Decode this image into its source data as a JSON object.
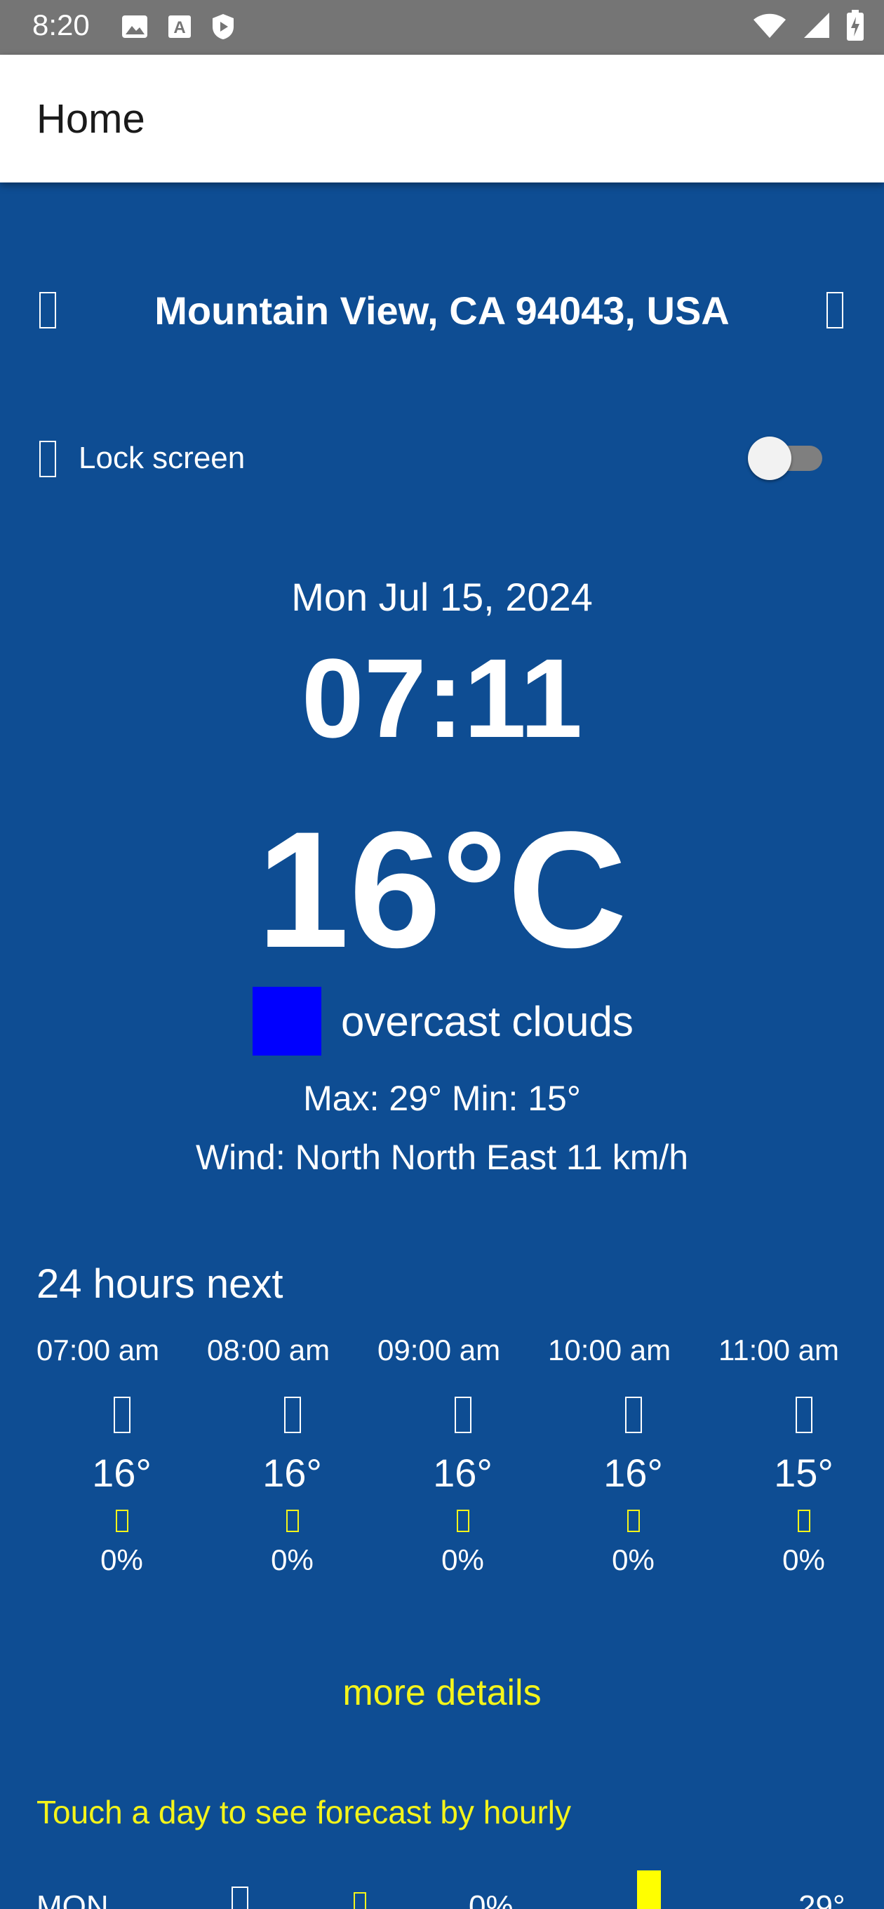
{
  "status_bar": {
    "time": "8:20",
    "left_icons": [
      "image-icon",
      "font-a-icon",
      "shield-play-icon"
    ],
    "right_icons": [
      "wifi-icon",
      "signal-icon",
      "battery-charging-icon"
    ]
  },
  "app_bar": {
    "title": "Home"
  },
  "header": {
    "location": "Mountain View, CA 94043, USA",
    "left_icon": "placeholder-icon",
    "right_icon": "placeholder-icon"
  },
  "lock": {
    "label": "Lock screen",
    "toggle_on": false
  },
  "current": {
    "date": "Mon Jul 15, 2024",
    "time": "07:11",
    "temperature": "16°C",
    "condition": "overcast clouds",
    "condition_swatch_color": "#0000ff",
    "max_min": "Max: 29° Min: 15°",
    "wind": "Wind: North North East 11 km/h"
  },
  "hourly": {
    "title": "24 hours next",
    "items": [
      {
        "time": "07:00 am",
        "temp": "16°",
        "pop": "0%"
      },
      {
        "time": "08:00 am",
        "temp": "16°",
        "pop": "0%"
      },
      {
        "time": "09:00 am",
        "temp": "16°",
        "pop": "0%"
      },
      {
        "time": "10:00 am",
        "temp": "16°",
        "pop": "0%"
      },
      {
        "time": "11:00 am",
        "temp": "15°",
        "pop": "0%"
      }
    ]
  },
  "more_details": "more details",
  "daily": {
    "hint": "Touch a day to see forecast by hourly",
    "first_row": {
      "day": "MON",
      "pop": "0%",
      "temp": "29°"
    }
  },
  "colors": {
    "background": "#0e4d93",
    "accent_yellow": "#f4f41a",
    "status_bar": "#757575",
    "bar_yellow": "#ffff00"
  }
}
